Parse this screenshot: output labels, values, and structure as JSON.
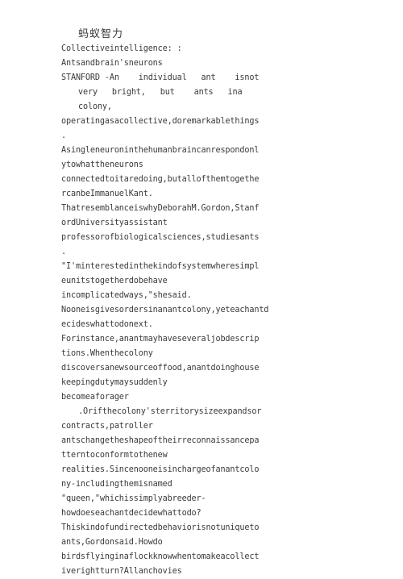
{
  "document": {
    "title_cjk": "蚂蚁智力",
    "headline_1": "Collectiveintelligence: :",
    "headline_2": "Antsandbrain'sneurons",
    "lines": [
      {
        "text": "STANFORD -An    individual   ant    isnot",
        "indent": "none"
      },
      {
        "text": "very   bright,   but    ants   ina",
        "indent": "ind-1"
      },
      {
        "text": "colony,",
        "indent": "ind-1"
      },
      {
        "text": "operatingasacollective,doremarkablethings",
        "indent": "none"
      },
      {
        "text": ".",
        "indent": "none"
      },
      {
        "text": "Asingleneuroninthehumanbraincanrespondonl",
        "indent": "none"
      },
      {
        "text": "ytowhattheneurons",
        "indent": "none"
      },
      {
        "text": "connectedtoitaredoing,butallofthemtogethe",
        "indent": "none"
      },
      {
        "text": "rcanbeImmanuelKant.",
        "indent": "none"
      },
      {
        "text": "ThatresemblanceiswhyDeborahM.Gordon,Stanf",
        "indent": "none"
      },
      {
        "text": "ordUniversityassistant",
        "indent": "none"
      },
      {
        "text": "professorofbiologicalsciences,studiesants",
        "indent": "none"
      },
      {
        "text": ".",
        "indent": "none"
      },
      {
        "text": "\"I'minterestedinthekindofsystemwheresimpl",
        "indent": "none"
      },
      {
        "text": "eunitstogetherdobehave",
        "indent": "none"
      },
      {
        "text": "incomplicatedways,\"shesaid.",
        "indent": "none"
      },
      {
        "text": "Nooneisgivesordersinanantcolony,yeteachantd",
        "indent": "none"
      },
      {
        "text": "ecideswhattodonext.",
        "indent": "none"
      },
      {
        "text": "Forinstance,anantmayhaveseveraljobdescrip",
        "indent": "none"
      },
      {
        "text": "tions.Whenthecolony",
        "indent": "none"
      },
      {
        "text": "discoversanewsourceoffood,anantdoinghouse",
        "indent": "none"
      },
      {
        "text": "keepingdutymaysuddenly",
        "indent": "none"
      },
      {
        "text": "becomeaforager",
        "indent": "none"
      },
      {
        "text": ".Orifthecolony'sterritorysizeexpandsor",
        "indent": "ind-2"
      },
      {
        "text": "contracts,patroller",
        "indent": "none"
      },
      {
        "text": "antschangetheshapeoftheirreconnaissancepa",
        "indent": "none"
      },
      {
        "text": "tterntoconformtothenew",
        "indent": "none"
      },
      {
        "text": "realities.Sincenooneisinchargeofanantcolo",
        "indent": "none"
      },
      {
        "text": "ny-includingthemisnamed",
        "indent": "none"
      },
      {
        "text": "\"queen,\"whichissimplyabreeder-",
        "indent": "none"
      },
      {
        "text": "howdoeseachantdecidewhattodo?",
        "indent": "none"
      },
      {
        "text": "Thiskindofundirectedbehaviorisnotuniqueto",
        "indent": "none"
      },
      {
        "text": "ants,Gordonsaid.Howdo",
        "indent": "none"
      },
      {
        "text": "birdsflyinginaflockknowwhentomakeacollect",
        "indent": "none"
      },
      {
        "text": "iverightturn?Allanchovies",
        "indent": "none"
      }
    ]
  },
  "colors": {
    "page_background": "#ffffff",
    "text": "#3a3a3a"
  }
}
